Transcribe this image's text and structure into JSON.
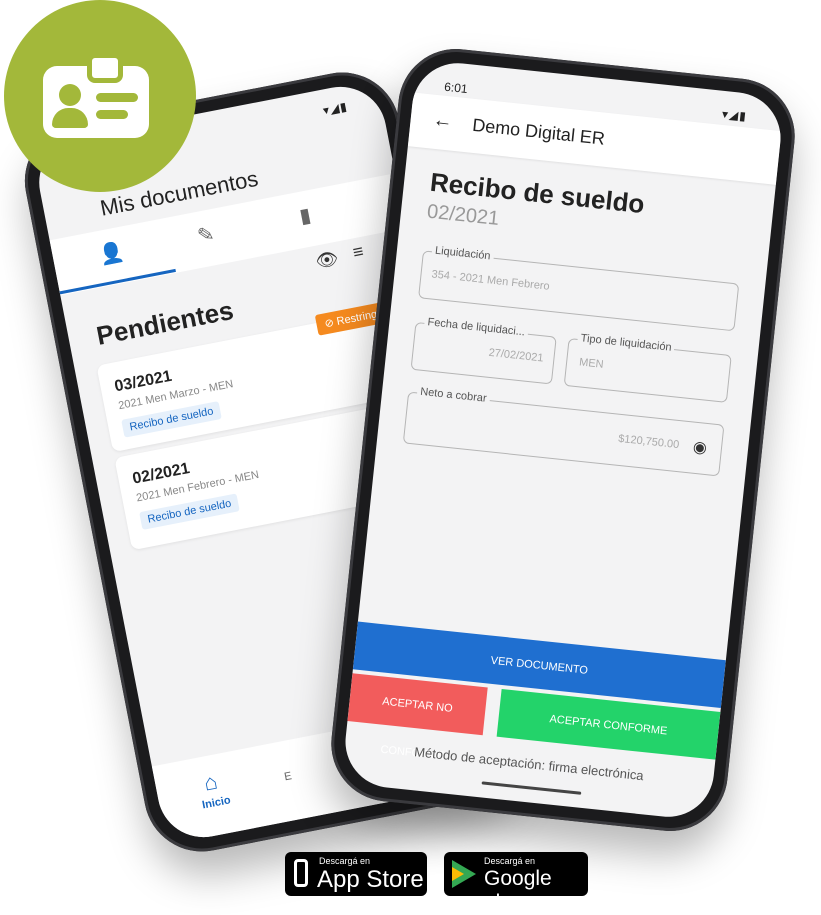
{
  "colors": {
    "badge": "#a3b83a",
    "primary": "#1565c0",
    "restricted": "#f58a1f",
    "reject": "#f25c5c",
    "accept": "#23d36a",
    "view": "#1f6fd0"
  },
  "icons": [
    "id-card-icon",
    "user-clock-icon",
    "document-edit-icon",
    "document-alert-icon",
    "eye-icon",
    "filter-icon",
    "home-icon",
    "back-arrow-icon",
    "eye-off-icon",
    "apple-icon",
    "google-play-icon"
  ],
  "left_phone": {
    "status": "▾◢▮",
    "title": "Mis documentos",
    "section_title": "Pendientes",
    "cards": [
      {
        "period": "03/2021",
        "description": "2021 Men Marzo - MEN",
        "tag": "Recibo de sueldo",
        "badge": "⊘ Restringido"
      },
      {
        "period": "02/2021",
        "description": "2021 Men Febrero - MEN",
        "tag": "Recibo de sueldo",
        "amount": "$******"
      }
    ],
    "bottom_nav": {
      "home_label": "Inicio",
      "second_label": "E"
    }
  },
  "right_phone": {
    "time": "6:01",
    "status": "▾◢▮",
    "app_title": "Demo Digital ER",
    "heading": "Recibo de sueldo",
    "period": "02/2021",
    "fields": {
      "liquidacion": {
        "label": "Liquidación",
        "value": "354 - 2021 Men Febrero"
      },
      "fecha": {
        "label": "Fecha de liquidaci...",
        "value": "27/02/2021"
      },
      "tipo": {
        "label": "Tipo de liquidación",
        "value": "MEN"
      },
      "neto": {
        "label": "Neto a cobrar",
        "value": "$120,750.00"
      }
    },
    "buttons": {
      "view": "VER DOCUMENTO",
      "reject": "ACEPTAR NO CONFORME",
      "accept": "ACEPTAR CONFORME"
    },
    "method": "Método de aceptación: firma electrónica"
  },
  "stores": {
    "apple": {
      "small": "Descargá en",
      "big": "App Store"
    },
    "google": {
      "small": "Descargá en",
      "big": "Google play"
    }
  }
}
